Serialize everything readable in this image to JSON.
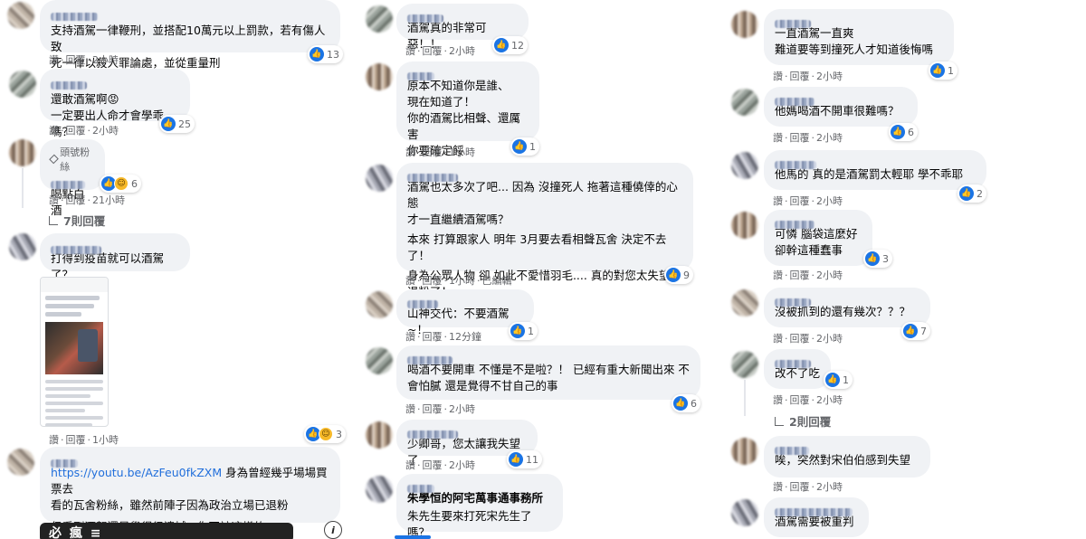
{
  "columns": [
    {
      "comments": [
        {
          "text": "支持酒駕一律鞭刑，並搭配10萬元以上罰款，若有傷人致\n死一律以殺人罪論處，並從重量刑",
          "meta": [
            "讚",
            "回覆",
            "2小時"
          ],
          "reactions": {
            "like": true,
            "count": "13"
          }
        },
        {
          "text": "還敢酒駕啊😡\n一定要出人命才會學乖嗎？",
          "meta": [
            "讚",
            "回覆",
            "2小時"
          ],
          "reactions": {
            "like": true,
            "count": "25"
          }
        },
        {
          "badge": "頭號粉絲",
          "text": "喝點白酒",
          "meta": [
            "讚",
            "回覆",
            "21小時"
          ],
          "reactions": {
            "like": true,
            "haha": true,
            "count": "6"
          },
          "replies": "7則回覆"
        },
        {
          "text": "打得到疫苗就可以酒駕了？",
          "meta": [
            "讚",
            "回覆",
            "1小時"
          ],
          "reactions": {
            "like": true,
            "haha": true,
            "count": "3"
          }
        },
        {
          "link": "https://youtu.be/AzFeu0fkZXM",
          "text_after_link": " 身為曾經幾乎場場買票去\n看的瓦舍粉絲，雖然前陣子因為政治立場已退粉",
          "text2": "但看到酒駕還是覺得很遺憾...你不該這樣的",
          "preview_label": "必 瘋 ≡",
          "info": "i"
        }
      ]
    },
    {
      "comments": [
        {
          "text": "酒駕真的非常可惡！！",
          "meta": [
            "讚",
            "回覆",
            "2小時"
          ],
          "reactions": {
            "like": true,
            "count": "12"
          }
        },
        {
          "text": "原本不知道你是誰、\n現在知道了！\n你的酒駕比相聲、還厲害\n你要確定餒",
          "meta": [
            "讚",
            "回覆",
            "1小時"
          ],
          "reactions": {
            "like": true,
            "count": "1"
          }
        },
        {
          "text": "酒駕也太多次了吧... 因為 沒撞死人 拖著這種僥倖的心態\n才一直繼續酒駕嗎？",
          "text2": "本來 打算跟家人 明年 3月要去看相聲瓦舍 決定不去了！",
          "text3": "身為公眾人物 卻 如此不愛惜羽毛.... 真的對您太失望\n退粉了！",
          "meta": [
            "讚",
            "回覆",
            "1小時",
            "已編輯"
          ],
          "reactions": {
            "like": true,
            "count": "9"
          }
        },
        {
          "text": "山神交代：不要酒駕~！",
          "meta": [
            "讚",
            "回覆",
            "12分鐘"
          ],
          "reactions": {
            "like": true,
            "count": "1"
          }
        },
        {
          "text": "喝酒不要開車 不懂是不是啦？！ 已經有重大新聞出來 不\n會怕膩 還是覺得不甘自己的事",
          "meta": [
            "讚",
            "回覆",
            "2小時"
          ],
          "reactions": {
            "like": true,
            "count": "6"
          }
        },
        {
          "text": "少卿哥，您太讓我失望了",
          "meta": [
            "讚",
            "回覆",
            "2小時"
          ],
          "reactions": {
            "like": true,
            "count": "11"
          }
        },
        {
          "bold_text": "朱學恒的阿宅萬事通事務所",
          "text": "朱先生要來打死宋先生了嗎？"
        }
      ]
    },
    {
      "comments": [
        {
          "text": "一直酒駕一直爽\n難道要等到撞死人才知道後悔嗎",
          "meta": [
            "讚",
            "回覆",
            "2小時"
          ],
          "reactions": {
            "like": true,
            "count": "1"
          }
        },
        {
          "text": "他媽喝酒不開車很難嗎？",
          "meta": [
            "讚",
            "回覆",
            "2小時"
          ],
          "reactions": {
            "like": true,
            "count": "6"
          }
        },
        {
          "text": "他馬的 真的是酒駕罰太輕耶 學不乖耶",
          "meta": [
            "讚",
            "回覆",
            "2小時"
          ],
          "reactions": {
            "like": true,
            "count": "2"
          }
        },
        {
          "text": "可憐 腦袋這麼好\n卻幹這種蠢事",
          "meta": [
            "讚",
            "回覆",
            "2小時"
          ],
          "reactions": {
            "like": true,
            "count": "3"
          }
        },
        {
          "text": "沒被抓到的還有幾次？？？",
          "meta": [
            "讚",
            "回覆",
            "2小時"
          ],
          "reactions": {
            "like": true,
            "count": "7"
          }
        },
        {
          "text": "改不了吃",
          "meta": [
            "讚",
            "回覆",
            "2小時"
          ],
          "reactions": {
            "like": true,
            "count": "1"
          },
          "replies": "2則回覆"
        },
        {
          "text": "唉，突然對宋伯伯感到失望",
          "meta": [
            "讚",
            "回覆",
            "2小時"
          ]
        },
        {
          "text": "酒駕需要被重判"
        }
      ]
    }
  ],
  "colors": {
    "bubble": "#f0f2f5",
    "meta": "#65676b",
    "link": "#216fdb",
    "like": "#1b74e4"
  }
}
